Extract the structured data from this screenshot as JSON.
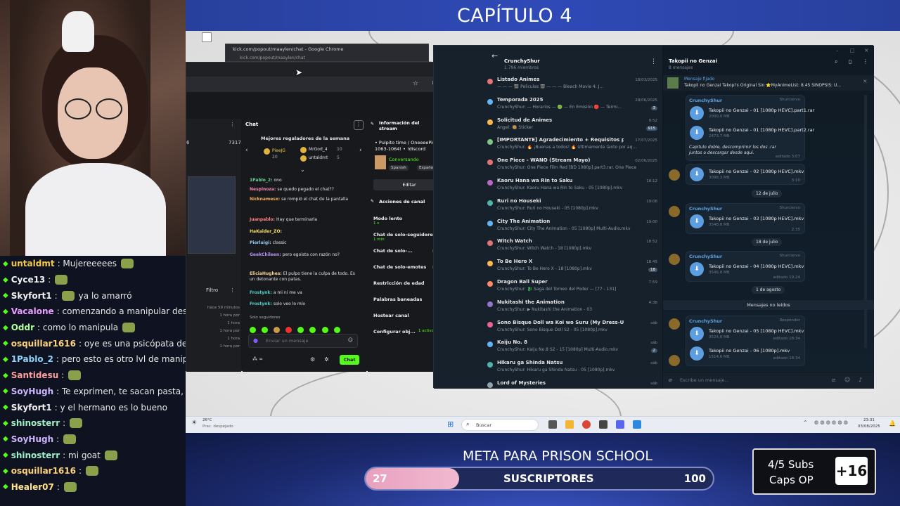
{
  "overlay": {
    "chapter_title": "CAPÍTULO 4",
    "goal_title": "META PARA PRISON SCHOOL",
    "goal_label": "SUSCRIPTORES",
    "goal_current": "27",
    "goal_target": "100",
    "goal_progress": 0.27,
    "subs_line1": "4/5 Subs",
    "subs_line2": "Caps OP",
    "subs_bonus": "+16"
  },
  "stream_chat": [
    {
      "user": "untaldmt",
      "text": ": Mujereeeees",
      "color": "#f2c94c",
      "emote": "frog-emote"
    },
    {
      "user": "Cyce13",
      "text": ":",
      "color": "#f2f2f2",
      "emote": "blob-emote"
    },
    {
      "user": "Skyfort1",
      "text": ":",
      "text2": "ya lo amarró",
      "color": "#f2f2f2",
      "emote": "blob-emote"
    },
    {
      "user": "Vacalone",
      "text": ": comenzando a manipular desde",
      "color": "#e9a0ff"
    },
    {
      "user": "Oddr",
      "text": ": como lo manipula",
      "color": "#b3ff9c",
      "emote": "frog-emote"
    },
    {
      "user": "osquillar1616",
      "text": ": oye es una psicópata de cuida",
      "color": "#ffd27a"
    },
    {
      "user": "1Pablo_2",
      "text": ": pero esto es otro lvl de manipul",
      "color": "#8fd3ff"
    },
    {
      "user": "Santidesu",
      "text": ":",
      "color": "#ff9f9f",
      "emote": "photo-emote"
    },
    {
      "user": "SoyHugh",
      "text": ": Te exprimen, te sacan pasta, te arr",
      "color": "#cdb7ff"
    },
    {
      "user": "Skyfort1",
      "text": ": y el hermano es lo bueno",
      "color": "#f2f2f2"
    },
    {
      "user": "shinosterr",
      "text": ":",
      "color": "#9ff0c8",
      "emote": "photo-emote"
    },
    {
      "user": "SoyHugh",
      "text": ":",
      "color": "#cdb7ff",
      "emote": "cat-emote"
    },
    {
      "user": "shinosterr",
      "text": ": mi goat",
      "color": "#9ff0c8",
      "emote": "hand-emote"
    },
    {
      "user": "osquillar1616",
      "text": ":",
      "color": "#ffd27a",
      "emote": "cat-emote"
    },
    {
      "user": "Healer07",
      "text": ":",
      "color": "#ffe48a",
      "emote": "cat-emote"
    }
  ],
  "chrome": {
    "tab_title": "kick.com/popout/maaylen/chat - Google Chrome",
    "address": "kick.com/popout/maaylen/chat"
  },
  "kick": {
    "left_panel": {
      "stat_a": "6",
      "stat_b": "7317",
      "filter_label": "Filtro",
      "times": [
        "hace 59 minutos",
        "1 hora por",
        "1 hora",
        "1 hora por",
        "1 hora",
        "1 hora por"
      ]
    },
    "chat": {
      "header": "Chat",
      "top_gifters_title": "Mejores regaladores de la semana",
      "gifters": [
        {
          "name": "PieeJG",
          "count": "20"
        },
        {
          "name": "MrGod_4",
          "count": "10"
        },
        {
          "name": "untaldmt",
          "count": "5"
        }
      ],
      "messages": [
        {
          "user": "1Pablo_2:",
          "text": "ono",
          "color": "#68d391"
        },
        {
          "user": "Nespinoza:",
          "text": "se quedo pegado el chat??",
          "color": "#f687b3"
        },
        {
          "user": "Nicknamesx:",
          "text": "se rompió el chat de la pantalla",
          "color": "#f6ad55"
        },
        {
          "user": "Juanpablo:",
          "text": "Hay que terminarla",
          "color": "#fc8181"
        },
        {
          "user": "HaKaider_ZO:",
          "text": "",
          "color": "#f6e05e"
        },
        {
          "user": "Pierluigi:",
          "text": "classic",
          "color": "#90cdf4"
        },
        {
          "user": "GeekChileen:",
          "text": "pero egoista con razón no?",
          "color": "#b794f4"
        },
        {
          "user": "EliciaHughes:",
          "text": "El pulpo tiene la culpa de todo. Es un detonante con patas.",
          "color": "#fbd38d"
        },
        {
          "user": "Frostynk:",
          "text": "a mi ni me va",
          "color": "#4fd1c5"
        },
        {
          "user": "Frostynk:",
          "text": "solo veo lo mío",
          "color": "#4fd1c5"
        }
      ],
      "followers_only": "Solo seguidores",
      "input_placeholder": "Enviar un mensaje",
      "send_label": "Chat"
    },
    "info": {
      "header": "Información del stream",
      "stream_title": "• Pulpito time / OneeeePisu 1063-1064! • !discord",
      "category": "Conversando",
      "tags": [
        "Spanish",
        "Español"
      ],
      "edit_label": "Editar"
    },
    "actions": {
      "header": "Acciones de canal",
      "items": [
        {
          "label": "Modo lento",
          "sub": "1 s",
          "kind": "chevron"
        },
        {
          "label": "Chat de solo-seguidores",
          "sub": "1 min",
          "kind": "chevron"
        },
        {
          "label": "Chat de solo-...",
          "sub": "",
          "kind": "toggle"
        },
        {
          "label": "Chat de solo-emotes",
          "sub": "",
          "kind": "toggle"
        },
        {
          "label": "Restricción de edad",
          "sub": "",
          "kind": "chevron"
        },
        {
          "label": "Palabras baneadas",
          "sub": "",
          "kind": "chevron"
        },
        {
          "label": "Hostear canal",
          "sub": "",
          "kind": "none"
        },
        {
          "label": "Configurar obj...",
          "sub": "1 activos",
          "kind": "chevron"
        }
      ]
    }
  },
  "telegram": {
    "channel_name": "CrunchyShur",
    "channel_members": "1.796 miembros",
    "chat_name": "Takopii no Genzai",
    "chat_count": "8 mensajes",
    "pinned_label": "Mensaje fijado",
    "pinned_text": "Takopii no Genzai Takopi's Original Sin ⭐MyAnimeList: 8.45 SINOPSIS: U...",
    "topics": [
      {
        "name": "Listado Animes",
        "preview": "— — — 🎬 Peliculas 🎬 — — — Bleach Movie 4: J...",
        "time": "18/03/2025",
        "badge": "",
        "color": "#e57373"
      },
      {
        "name": "Temporada 2025",
        "preview": "CrunchyShur: — Horarios — 🟢 — En Emisión 🔴 — Termi...",
        "time": "28/06/2025",
        "badge": "3",
        "color": "#64b5f6"
      },
      {
        "name": "Solicitud de Animes",
        "preview": "Angel: 🥘 Sticker",
        "time": "0:52",
        "badge": "915",
        "color": "#ffb74d"
      },
      {
        "name": "[IMPORTANTE] Agradecimiento + Requisitos para subir ...",
        "preview": "CrunchyShur: 🔥 ¡Buenas a todos! 🔥 Últimamente tanto por aq...",
        "time": "17/07/2025",
        "badge": "",
        "color": "#81c784"
      },
      {
        "name": "One Piece - WANO (Stream Mayo)",
        "preview": "CrunchyShur: One Piece Film Red [BD 1080p].part3.rar. One Piece ...",
        "time": "02/06/2025",
        "badge": "",
        "color": "#e57373"
      },
      {
        "name": "Kaoru Hana wa Rin to Saku",
        "preview": "CrunchyShur: Kaoru Hana wa Rin to Saku - 05 [1080p].mkv",
        "time": "18:12",
        "badge": "",
        "color": "#ba68c8"
      },
      {
        "name": "Ruri no Houseki",
        "preview": "CrunchyShur: Ruri no Houseki - 05 [1080p].mkv",
        "time": "19:08",
        "badge": "",
        "color": "#4db6ac"
      },
      {
        "name": "City The Animation",
        "preview": "CrunchyShur: City The Animation - 05 [1080p] Multi-Audio.mkv",
        "time": "19:00",
        "badge": "",
        "color": "#64b5f6"
      },
      {
        "name": "Witch Watch",
        "preview": "CrunchyShur: Witch Watch - 18 [1080p].mkv",
        "time": "18:52",
        "badge": "",
        "color": "#e57373"
      },
      {
        "name": "To Be Hero X",
        "preview": "CrunchyShur: To Be Hero X - 18 [1080p].mkv",
        "time": "18:45",
        "badge": "18",
        "color": "#ffb74d"
      },
      {
        "name": "Dragon Ball Super",
        "preview": "CrunchyShur: 🐉 Saga del Torneo del Poder — [77 - 131]",
        "time": "7:59",
        "badge": "",
        "color": "#ff8a65"
      },
      {
        "name": "Nukitashi the Animation",
        "preview": "CrunchyShur: ▶ Nukitashi the Animation - 03",
        "time": "4:38",
        "badge": "",
        "color": "#9575cd"
      },
      {
        "name": "Sono Bisque Doll wa Koi wo Suru (My Dress-Up Darling)",
        "preview": "CrunchyShur: Sono Bisque Doll S2 - 05 [1080p].mkv",
        "time": "sáb",
        "badge": "",
        "color": "#f06292"
      },
      {
        "name": "Kaiju No. 8",
        "preview": "CrunchyShur: Kaiju No.8 S2 - 15 [1080p] Multi-Audio.mkv",
        "time": "sáb",
        "badge": "2",
        "color": "#64b5f6"
      },
      {
        "name": "Hikaru ga Shinda Natsu",
        "preview": "CrunchyShur: Hikaru ga Shinda Natsu - 05 [1080p].mkv",
        "time": "sáb",
        "badge": "",
        "color": "#4db6ac"
      },
      {
        "name": "Lord of Mysteries",
        "preview": "",
        "time": "sáb",
        "badge": "",
        "color": "#90a4ae"
      }
    ],
    "messages": [
      {
        "author": "CrunchyShur",
        "role": "Shurciervo",
        "files": [
          {
            "name": "Takopii no Genzai - 01 [1080p HEVC].part1.rar",
            "size": "2000,0 MB"
          },
          {
            "name": "Takopii no Genzai - 01 [1080p HEVC].part2.rar",
            "size": "2473,7 MB"
          }
        ],
        "caption": "Capitulo doble, descomprimir los dos .rar juntos o descargar desde aqui.",
        "time": "editado 3:07"
      },
      {
        "author": "",
        "role": "",
        "files": [
          {
            "name": "Takopii no Genzai - 02 [1080p HEVC].mkv",
            "size": "3098,3 MB"
          }
        ],
        "caption": "",
        "time": "3:10"
      }
    ],
    "date_1": "12 de julio",
    "msg_2": {
      "author": "CrunchyShur",
      "role": "Shurciervo",
      "file": "Takopii no Genzai - 03 [1080p HEVC].mkv",
      "size": "3548,8 MB",
      "time": "2:35"
    },
    "date_2": "18 de julio",
    "msg_3": {
      "author": "CrunchyShur",
      "role": "Shurciervo",
      "file": "Takopii no Genzai - 04 [1080p HEVC].mkv",
      "size": "3546,8 MB",
      "time": "editado 19:24"
    },
    "date_3": "1 de agosto",
    "unread": "Mensajes no leídos",
    "msg_4": {
      "author": "CrunchyShur",
      "role": "Responder",
      "files": [
        {
          "name": "Takopii no Genzai - 05 [1080p HEVC].mkv",
          "size": "3524,6 MB",
          "time": "editado 18:34"
        },
        {
          "name": "Takopii no Genzai - 06 [1080p].mkv",
          "size": "1514,6 MB",
          "time": "editado 18:34"
        }
      ]
    },
    "input_placeholder": "Escribe un mensaje..."
  },
  "taskbar": {
    "weather_temp": "26°C",
    "weather_text": "Prac. despejado",
    "search": "Buscar",
    "time": "23:31",
    "date": "03/08/2025"
  },
  "colors": {
    "kick_green": "#53fc18",
    "telegram_bg": "#17212b",
    "overlay_blue": "#2f4ab7"
  }
}
